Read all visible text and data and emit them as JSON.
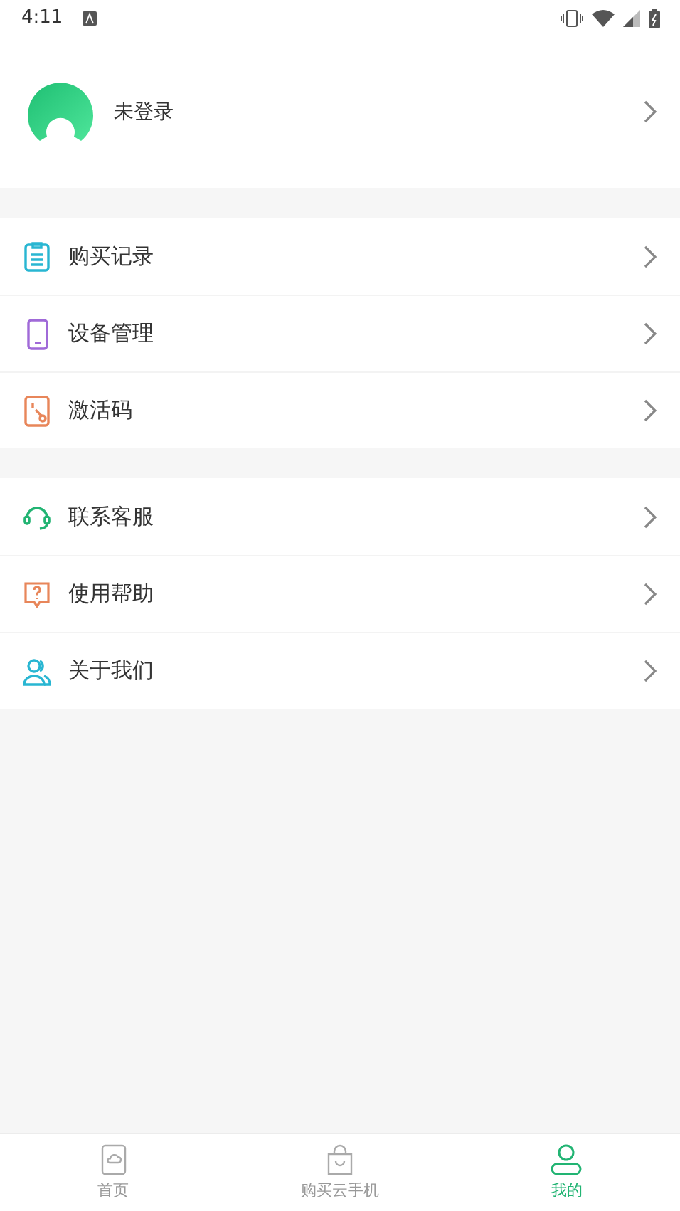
{
  "status_bar": {
    "time": "4:11"
  },
  "profile": {
    "name": "未登录"
  },
  "menu_groups": [
    [
      {
        "label": "购买记录"
      },
      {
        "label": "设备管理"
      },
      {
        "label": "激活码"
      }
    ],
    [
      {
        "label": "联系客服"
      },
      {
        "label": "使用帮助"
      },
      {
        "label": "关于我们"
      }
    ]
  ],
  "bottom_nav": [
    {
      "label": "首页",
      "selected": false
    },
    {
      "label": "购买云手机",
      "selected": false
    },
    {
      "label": "我的",
      "selected": true
    }
  ]
}
